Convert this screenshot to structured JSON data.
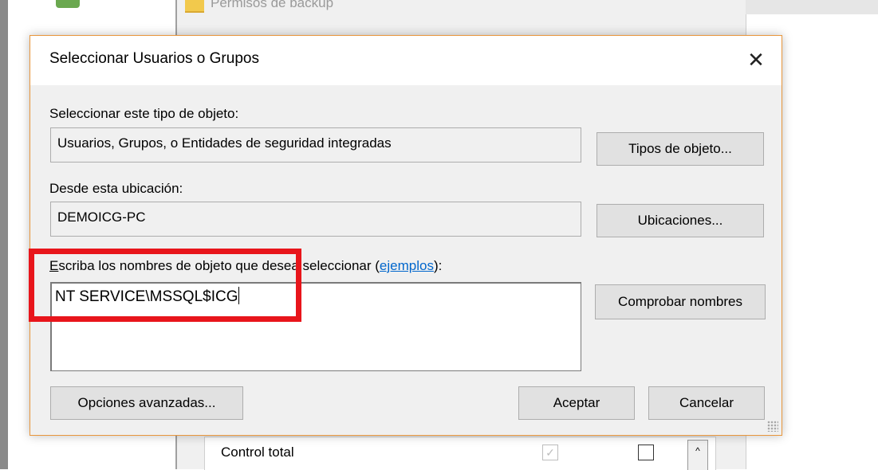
{
  "background": {
    "folder_label": "Permisos de backup",
    "permission_row_label": "Control total",
    "scroll_up_glyph": "^",
    "checkmark_glyph": "✓"
  },
  "dialog": {
    "title": "Seleccionar Usuarios o Grupos",
    "close_glyph": "✕",
    "object_type": {
      "label": "Seleccionar este tipo de objeto:",
      "value": "Usuarios, Grupos, o Entidades de seguridad integradas",
      "button": "Tipos de objeto..."
    },
    "location": {
      "label": "Desde esta ubicación:",
      "value": "DEMOICG-PC",
      "button": "Ubicaciones..."
    },
    "names": {
      "label_accel": "E",
      "label_rest": "scriba los nombres de objeto que desea seleccionar (",
      "link": "ejemplos",
      "label_end": "):",
      "value": "NT SERVICE\\MSSQL$ICG",
      "check_button": "Comprobar nombres"
    },
    "buttons": {
      "advanced": "Opciones avanzadas...",
      "ok": "Aceptar",
      "cancel": "Cancelar"
    }
  },
  "colors": {
    "highlight": "#e8151b",
    "dialog_border": "#e8963c",
    "link": "#0066cc"
  }
}
